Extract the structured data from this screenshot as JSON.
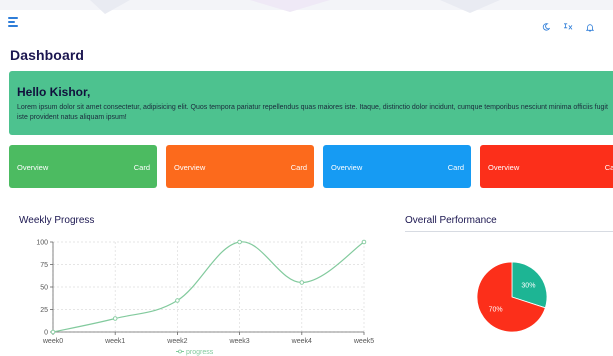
{
  "header": {
    "menu_icon": "hamburger-menu-icon",
    "icons": [
      "moon-icon",
      "language-icon",
      "bell-icon"
    ],
    "accent_color": "#2e7dd8"
  },
  "page": {
    "title": "Dashboard"
  },
  "welcome": {
    "title": "Hello Kishor,",
    "text": "Lorem ipsum dolor sit amet consectetur, adipisicing elit. Quos tempora pariatur repellendus quas maiores iste. Itaque, distinctio dolor incidunt, cumque temporibus nesciunt minima officiis fugit iste provident natus aliquam ipsum!",
    "color": "#4dc28f"
  },
  "cards": [
    {
      "label": "Overview",
      "right": "Card",
      "color": "#4cbb61"
    },
    {
      "label": "Overview",
      "right": "Card",
      "color": "#fc6a1c"
    },
    {
      "label": "Overview",
      "right": "Card",
      "color": "#169bf3"
    },
    {
      "label": "Overview",
      "right": "Card",
      "color": "#fc2f1a"
    }
  ],
  "weekly_progress": {
    "title": "Weekly Progress"
  },
  "overall_performance": {
    "title": "Overall Performance"
  },
  "chart_data": [
    {
      "type": "line",
      "title": "Weekly Progress",
      "x": [
        "week0",
        "week1",
        "week2",
        "week3",
        "week4",
        "week5"
      ],
      "series": [
        {
          "name": "progress",
          "values": [
            0,
            15,
            35,
            100,
            55,
            100
          ],
          "color": "#82ca9d"
        }
      ],
      "y_ticks": [
        0,
        25,
        50,
        75,
        100
      ],
      "ylim": [
        0,
        100
      ],
      "grid": true,
      "legend": "bottom"
    },
    {
      "type": "pie",
      "title": "Overall Performance",
      "slices": [
        {
          "label": "30%",
          "value": 30,
          "color": "#1db594"
        },
        {
          "label": "70%",
          "value": 70,
          "color": "#fc2f1a"
        }
      ]
    }
  ]
}
